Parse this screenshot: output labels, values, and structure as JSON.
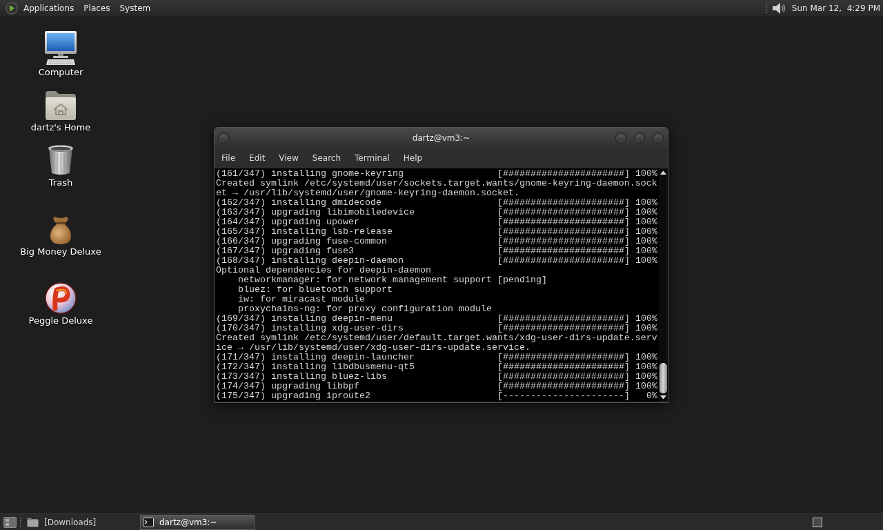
{
  "top_panel": {
    "menus": [
      "Applications",
      "Places",
      "System"
    ],
    "clock": "Sun Mar 12,  4:29 PM"
  },
  "desktop": {
    "icons": [
      "Computer",
      "dartz's Home",
      "Trash",
      "Big Money Deluxe",
      "Peggle Deluxe"
    ]
  },
  "terminal_window": {
    "title": "dartz@vm3:~",
    "menu": [
      "File",
      "Edit",
      "View",
      "Search",
      "Terminal",
      "Help"
    ],
    "lines": [
      {
        "kind": "progress",
        "text": "(161/347) installing gnome-keyring",
        "bar": "[######################]",
        "percent": "100%"
      },
      {
        "kind": "plain",
        "text": "Created symlink /etc/systemd/user/sockets.target.wants/gnome-keyring-daemon.sock"
      },
      {
        "kind": "plain",
        "text": "et → /usr/lib/systemd/user/gnome-keyring-daemon.socket."
      },
      {
        "kind": "progress",
        "text": "(162/347) installing dmidecode",
        "bar": "[######################]",
        "percent": "100%"
      },
      {
        "kind": "progress",
        "text": "(163/347) upgrading libimobiledevice",
        "bar": "[######################]",
        "percent": "100%"
      },
      {
        "kind": "progress",
        "text": "(164/347) upgrading upower",
        "bar": "[######################]",
        "percent": "100%"
      },
      {
        "kind": "progress",
        "text": "(165/347) installing lsb-release",
        "bar": "[######################]",
        "percent": "100%"
      },
      {
        "kind": "progress",
        "text": "(166/347) upgrading fuse-common",
        "bar": "[######################]",
        "percent": "100%"
      },
      {
        "kind": "progress",
        "text": "(167/347) upgrading fuse3",
        "bar": "[######################]",
        "percent": "100%"
      },
      {
        "kind": "progress",
        "text": "(168/347) installing deepin-daemon",
        "bar": "[######################]",
        "percent": "100%"
      },
      {
        "kind": "plain",
        "text": "Optional dependencies for deepin-daemon"
      },
      {
        "kind": "indented",
        "text": "networkmanager: for network management support [pending]"
      },
      {
        "kind": "indented",
        "text": "bluez: for bluetooth support"
      },
      {
        "kind": "indented",
        "text": "iw: for miracast module"
      },
      {
        "kind": "indented",
        "text": "proxychains-ng: for proxy configuration module"
      },
      {
        "kind": "progress",
        "text": "(169/347) installing deepin-menu",
        "bar": "[######################]",
        "percent": "100%"
      },
      {
        "kind": "progress",
        "text": "(170/347) installing xdg-user-dirs",
        "bar": "[######################]",
        "percent": "100%"
      },
      {
        "kind": "plain",
        "text": "Created symlink /etc/systemd/user/default.target.wants/xdg-user-dirs-update.serv"
      },
      {
        "kind": "plain",
        "text": "ice → /usr/lib/systemd/user/xdg-user-dirs-update.service."
      },
      {
        "kind": "progress",
        "text": "(171/347) installing deepin-launcher",
        "bar": "[######################]",
        "percent": "100%"
      },
      {
        "kind": "progress",
        "text": "(172/347) installing libdbusmenu-qt5",
        "bar": "[######################]",
        "percent": "100%"
      },
      {
        "kind": "progress",
        "text": "(173/347) installing bluez-libs",
        "bar": "[######################]",
        "percent": "100%"
      },
      {
        "kind": "progress",
        "text": "(174/347) upgrading libbpf",
        "bar": "[######################]",
        "percent": "100%"
      },
      {
        "kind": "progress",
        "text": "(175/347) upgrading iproute2",
        "bar": "[----------------------]",
        "percent": "0%"
      }
    ]
  },
  "taskbar": {
    "items": [
      {
        "label": "[Downloads]",
        "selected": false
      },
      {
        "label": "dartz@vm3:~",
        "selected": true
      }
    ]
  }
}
